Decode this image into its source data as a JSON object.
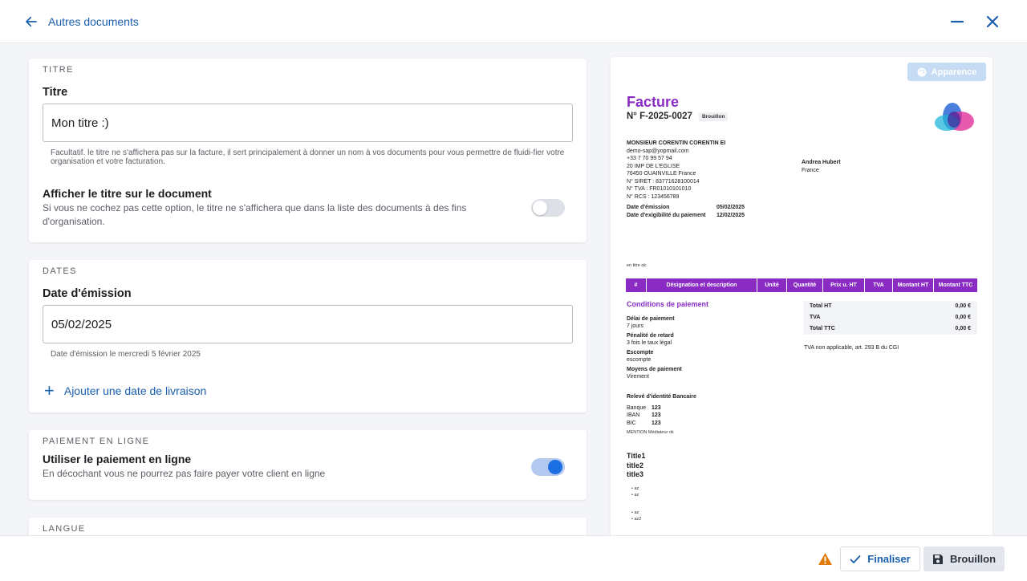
{
  "header": {
    "back_label": "Autres documents",
    "icons": [
      "arrow-left-icon",
      "minimize-icon",
      "close-icon"
    ]
  },
  "titre_section": {
    "section_label": "TITRE",
    "field_label": "Titre",
    "value": "Mon titre :)",
    "help": "Facultatif. le titre ne s'affichera pas sur la facture, il sert principalement à donner un nom à vos documents pour vous permettre de fluidi-fier votre organisation et votre facturation.",
    "option_title": "Afficher le titre sur le document",
    "option_desc_line1": "Si vous ne cochez pas cette option, le titre ne s'affichera que dans la liste des documents à des fins",
    "option_desc_line2": "d'organisation.",
    "option_enabled": false
  },
  "dates_section": {
    "section_label": "DATES",
    "field_label": "Date d'émission",
    "value": "05/02/2025",
    "help": "Date d'émission le mercredi 5 février 2025",
    "add_label": "Ajouter une date de livraison"
  },
  "paiement_section": {
    "section_label": "PAIEMENT EN LIGNE",
    "option_title": "Utiliser le paiement en ligne",
    "option_desc": "En décochant vous ne pourrez pas faire payer votre client en ligne",
    "option_enabled": true
  },
  "langue_section": {
    "section_label": "LANGUE"
  },
  "preview": {
    "appearance_label": "Apparence",
    "title": "Facture",
    "number": "N° F-2025-0027",
    "status_badge": "Brouillon",
    "seller": {
      "name": "MONSIEUR CORENTIN CORENTIN EI",
      "email": "demo-sap@yopmail.com",
      "phone": "+33 7 70 99 57 94",
      "address1": "20 IMP DE L'EGLISE",
      "address2": "76450 OUAINVILLE France",
      "siret": "N° SIRET : 83771628100014",
      "tva": "N° TVA : FR01010101010",
      "rcs": "N° RCS : 123456789"
    },
    "client": {
      "name": "Andrea Hubert",
      "country": "France"
    },
    "dates": {
      "emission_label": "Date d'émission",
      "emission_value": "05/02/2025",
      "due_label": "Date d'exigibilité du paiement",
      "due_value": "12/02/2025"
    },
    "subtitle": "en titre ok",
    "table_headers": [
      "#",
      "Désignation et description",
      "Unité",
      "Quantité",
      "Prix u. HT",
      "TVA",
      "Montant HT",
      "Montant TTC"
    ],
    "conditions": {
      "title": "Conditions de paiement",
      "delai_label": "Délai de paiement",
      "delai_value": "7 jours",
      "penalite_label": "Pénalité de retard",
      "penalite_value": "3 fois le taux légal",
      "escompte_label": "Escompte",
      "escompte_value": "escompte",
      "moyens_label": "Moyens de paiement",
      "moyens_value": "Virement"
    },
    "totals": [
      {
        "label": "Total HT",
        "value": "0,00 €"
      },
      {
        "label": "TVA",
        "value": "0,00 €"
      },
      {
        "label": "Total TTC",
        "value": "0,00 €"
      }
    ],
    "tva_note": "TVA non applicable, art. 293 B du CGI",
    "bank": {
      "title": "Relevé d'identité Bancaire",
      "banque_label": "Banque",
      "banque_value": "123",
      "iban_label": "IBAN",
      "iban_value": "123",
      "bic_label": "BIC",
      "bic_value": "123"
    },
    "mention": "MENTION Médiateur ok",
    "headings": [
      "Title1",
      "title2",
      "title3"
    ],
    "bullets_group1": [
      "az",
      "az"
    ],
    "bullets_group2": [
      "az",
      "az2"
    ],
    "colors": {
      "accent": "#8a2cc4"
    }
  },
  "footer": {
    "finaliser_label": "Finaliser",
    "brouillon_label": "Brouillon",
    "warning_icon": "warning-icon"
  }
}
